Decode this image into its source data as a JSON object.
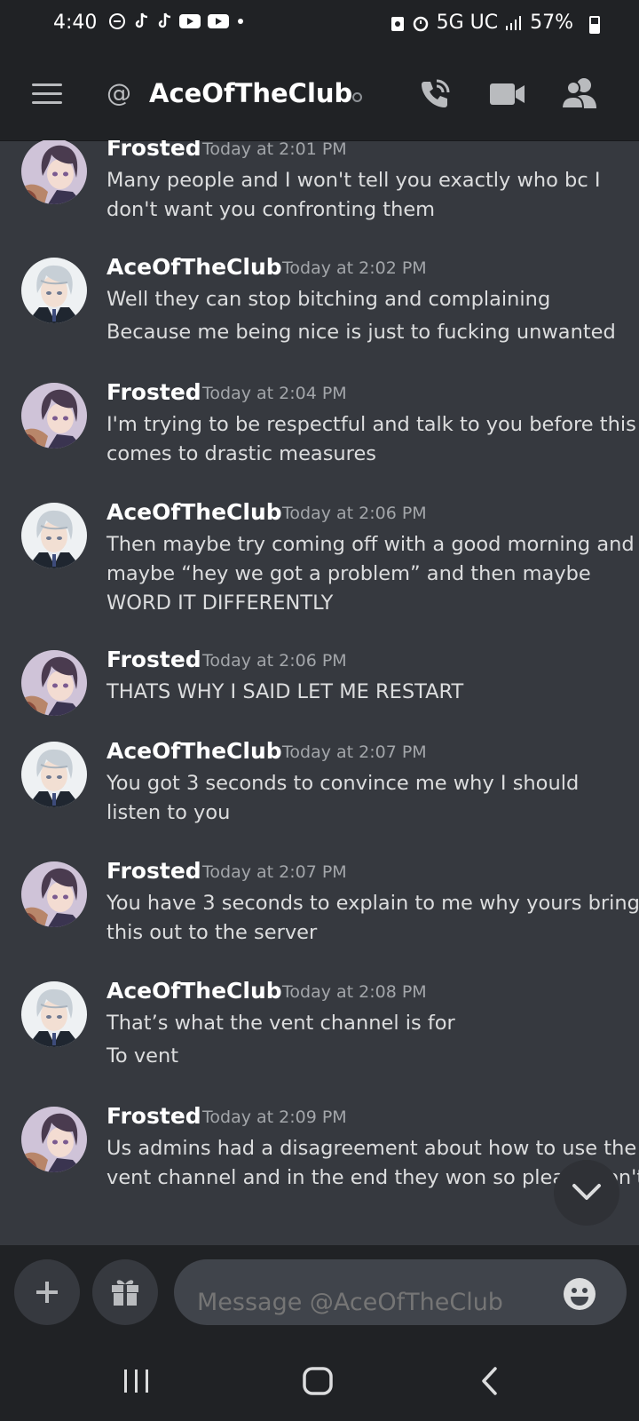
{
  "status_bar": {
    "time": "4:40",
    "network": "5G UC",
    "battery": "57%"
  },
  "header": {
    "at_symbol": "@",
    "channel_name": "AceOfTheClub"
  },
  "messages": [
    {
      "author": "Frosted",
      "timestamp": "Today at 2:01 PM",
      "avatar": "frosted",
      "lines": [
        "Many people and I won't tell you exactly who bc I",
        "don't want you confronting them"
      ]
    },
    {
      "author": "AceOfTheClub",
      "timestamp": "Today at 2:02 PM",
      "avatar": "ace",
      "lines": [
        "Well they can stop bitching and complaining",
        "Because me being nice is just to fucking unwanted"
      ]
    },
    {
      "author": "Frosted",
      "timestamp": "Today at 2:04 PM",
      "avatar": "frosted",
      "lines": [
        "I'm trying to be respectful and talk to you before this",
        "comes to drastic measures"
      ]
    },
    {
      "author": "AceOfTheClub",
      "timestamp": "Today at 2:06 PM",
      "avatar": "ace",
      "lines": [
        "Then maybe try coming off with a good morning and",
        "maybe “hey we got a problem” and then maybe",
        "WORD IT DIFFERENTLY"
      ]
    },
    {
      "author": "Frosted",
      "timestamp": "Today at 2:06 PM",
      "avatar": "frosted",
      "lines": [
        "THATS WHY I SAID LET ME RESTART"
      ]
    },
    {
      "author": "AceOfTheClub",
      "timestamp": "Today at 2:07 PM",
      "avatar": "ace",
      "lines": [
        "You got 3 seconds to convince me why I should",
        "listen to you"
      ]
    },
    {
      "author": "Frosted",
      "timestamp": "Today at 2:07 PM",
      "avatar": "frosted",
      "lines": [
        "You have 3 seconds to explain to me why yours bring",
        "this out to the server"
      ]
    },
    {
      "author": "AceOfTheClub",
      "timestamp": "Today at 2:08 PM",
      "avatar": "ace",
      "lines": [
        "That’s what the vent channel is for",
        "To vent"
      ]
    },
    {
      "author": "Frosted",
      "timestamp": "Today at 2:09 PM",
      "avatar": "frosted",
      "lines": [
        "Us admins had a disagreement about how to use the",
        "vent channel and in the end they won so please don't"
      ]
    }
  ],
  "composer": {
    "placeholder": "Message @AceOfTheClub"
  },
  "icons": {
    "menu": "hamburger-menu-icon",
    "call": "phone-call-icon",
    "video": "video-camera-icon",
    "members": "member-list-icon",
    "add": "plus-icon",
    "gift": "gift-icon",
    "emoji": "emoji-icon",
    "scroll": "chevron-down-icon"
  },
  "colors": {
    "background": "#36393f",
    "header": "#202225",
    "text": "#dcddde",
    "timestamp": "#a3a6aa"
  }
}
